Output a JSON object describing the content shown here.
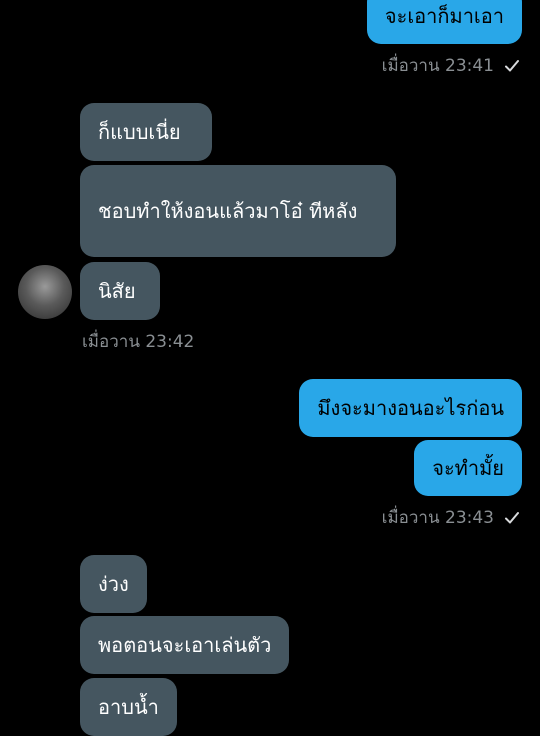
{
  "messages": [
    {
      "text": "จะเอาก็มาเอา",
      "dir": "out"
    },
    {
      "text": "ก็แบบเนี่ย",
      "dir": "in"
    },
    {
      "text": "ชอบทำให้งอนแล้วมาโอ๋ ทีหลัง",
      "dir": "in"
    },
    {
      "text": "นิสัย",
      "dir": "in"
    },
    {
      "text": "มึงจะมางอนอะไรก่อน",
      "dir": "out"
    },
    {
      "text": "จะทำมั้ย",
      "dir": "out"
    },
    {
      "text": "ง่วง",
      "dir": "in"
    },
    {
      "text": "พอตอนจะเอาเล่นตัว",
      "dir": "in"
    },
    {
      "text": "อาบน้ำ",
      "dir": "in"
    }
  ],
  "timestamps": [
    {
      "text": "เมื่อวาน 23:41",
      "dir": "out",
      "read_check": true
    },
    {
      "text": "เมื่อวาน 23:42",
      "dir": "in",
      "read_check": false
    },
    {
      "text": "เมื่อวาน 23:43",
      "dir": "out",
      "read_check": true
    }
  ],
  "colors": {
    "background": "#000000",
    "outgoing_bubble": "#29a7e8",
    "incoming_bubble": "#455660",
    "timestamp": "#8a8f93"
  },
  "icons": {
    "read": "check-icon",
    "sender": "avatar"
  }
}
